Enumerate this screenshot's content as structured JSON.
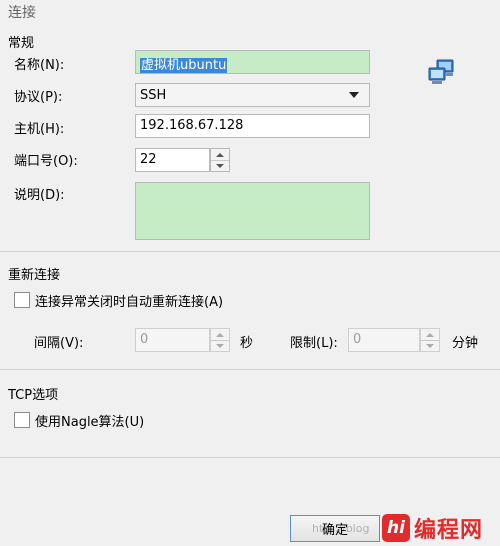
{
  "window": {
    "title": "连接"
  },
  "general": {
    "title": "常规",
    "name_label": "名称(N):",
    "name_value": "虚拟机ubuntu",
    "protocol_label": "协议(P):",
    "protocol_value": "SSH",
    "host_label": "主机(H):",
    "host_value": "192.168.67.128",
    "port_label": "端口号(O):",
    "port_value": "22",
    "desc_label": "说明(D):",
    "desc_value": ""
  },
  "reconnect": {
    "title": "重新连接",
    "checkbox_label": "连接异常关闭时自动重新连接(A)",
    "checked": false,
    "interval_label": "间隔(V):",
    "interval_value": "0",
    "interval_unit": "秒",
    "limit_label": "限制(L):",
    "limit_value": "0",
    "limit_unit": "分钟"
  },
  "tcp": {
    "title": "TCP选项",
    "nagle_label": "使用Nagle算法(U)",
    "checked": false
  },
  "footer": {
    "ok_label": "确定"
  },
  "watermark": {
    "logo_text": "hi",
    "site_text": "编程网",
    "faint_text": "http://blog"
  },
  "colors": {
    "field_green": "#c6ecc6",
    "selection_blue": "#3b88d8",
    "watermark_red": "#e22c2c"
  },
  "icons": {
    "session": "network-computers-icon"
  }
}
